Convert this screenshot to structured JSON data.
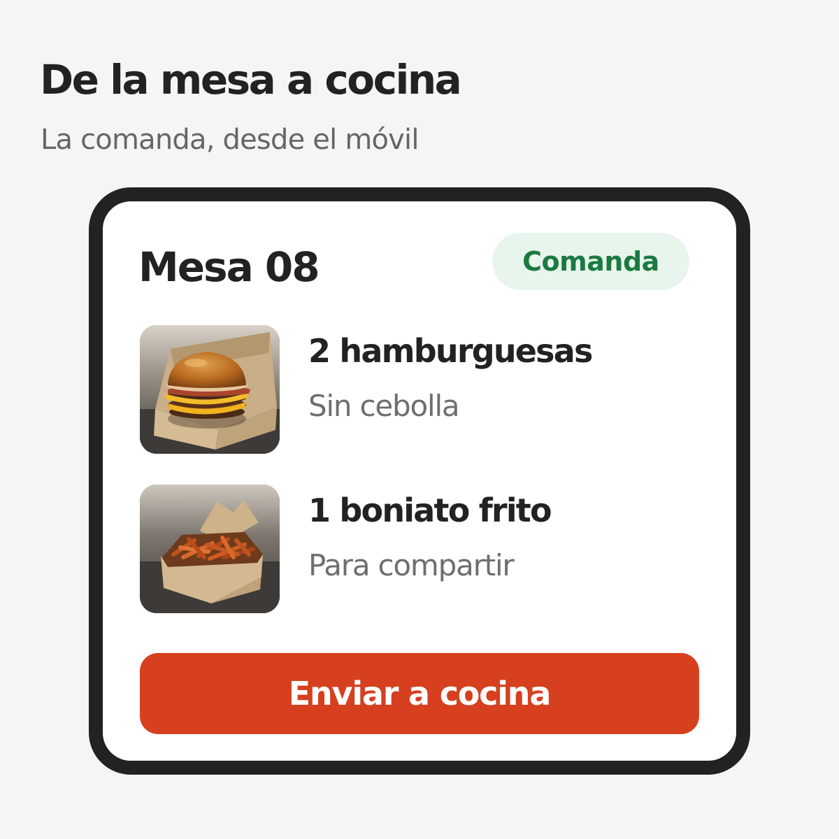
{
  "header": {
    "title": "De la mesa a cocina",
    "subtitle": "La comanda, desde el móvil"
  },
  "order": {
    "table": "Mesa 08",
    "status": "Comanda",
    "items": [
      {
        "name": "2 hamburguesas",
        "note": "Sin cebolla"
      },
      {
        "name": "1 boniato frito",
        "note": "Para compartir"
      }
    ],
    "send_label": "Enviar a cocina"
  },
  "colors": {
    "accent": "#d6401f",
    "status_bg": "#e8f5ec",
    "status_text": "#1a7a41",
    "frame": "#222222",
    "background": "#f5f5f5"
  }
}
